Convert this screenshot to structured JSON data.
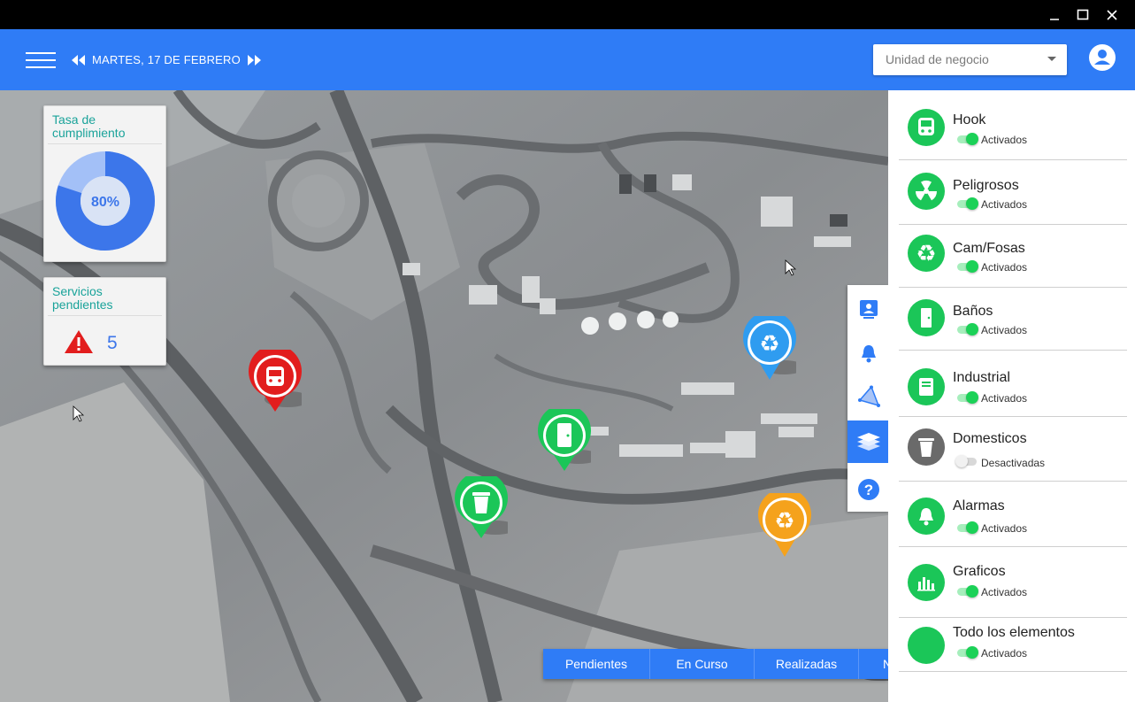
{
  "window": {
    "controls": [
      "minimize-icon",
      "maximize-icon",
      "close-icon"
    ]
  },
  "header": {
    "date": "MARTES, 17 DE FEBRERO",
    "business_unit_placeholder": "Unidad de negocio",
    "colors": {
      "accent": "#2f7cf6"
    }
  },
  "widgets": {
    "compliance": {
      "title": "Tasa de cumplimiento",
      "value_label": "80%",
      "value": 0.8
    },
    "pending": {
      "title": "Servicios pendientes",
      "count": "5"
    }
  },
  "markers": [
    {
      "type": "hook",
      "icon": "bus-icon",
      "color": "#e21d1d"
    },
    {
      "type": "banos",
      "icon": "toilet-door-icon",
      "color": "#1bc658"
    },
    {
      "type": "domesticos",
      "icon": "trash-icon",
      "color": "#1bc658"
    },
    {
      "type": "cam-fosas",
      "icon": "recycle-icon",
      "color": "#2f9cf0"
    },
    {
      "type": "cam-fosas",
      "icon": "recycle-icon",
      "color": "#f5a21c"
    }
  ],
  "tools": [
    "contact-card-icon",
    "bell-icon",
    "polygon-icon",
    "layers-icon",
    "help-icon"
  ],
  "tabs": [
    "Pendientes",
    "En Curso",
    "Realizadas",
    "N"
  ],
  "layers": [
    {
      "name": "Hook",
      "status": "Activados",
      "icon": "bus-icon",
      "on": true
    },
    {
      "name": "Peligrosos",
      "status": "Activados",
      "icon": "radiation-icon",
      "on": true
    },
    {
      "name": "Cam/Fosas",
      "status": "Activados",
      "icon": "recycle-icon",
      "on": true
    },
    {
      "name": "Baños",
      "status": "Activados",
      "icon": "door-icon",
      "on": true
    },
    {
      "name": "Industrial",
      "status": "Activados",
      "icon": "industrial-bin-icon",
      "on": true
    },
    {
      "name": "Domesticos",
      "status": "Desactivadas",
      "icon": "trash-icon",
      "on": false
    },
    {
      "name": "Alarmas",
      "status": "Activados",
      "icon": "bell-icon",
      "on": true
    },
    {
      "name": "Graficos",
      "status": "Activados",
      "icon": "bar-chart-icon",
      "on": true
    },
    {
      "name": "Todo los elementos",
      "status": "Activados",
      "icon": "circle-icon",
      "on": true
    }
  ]
}
